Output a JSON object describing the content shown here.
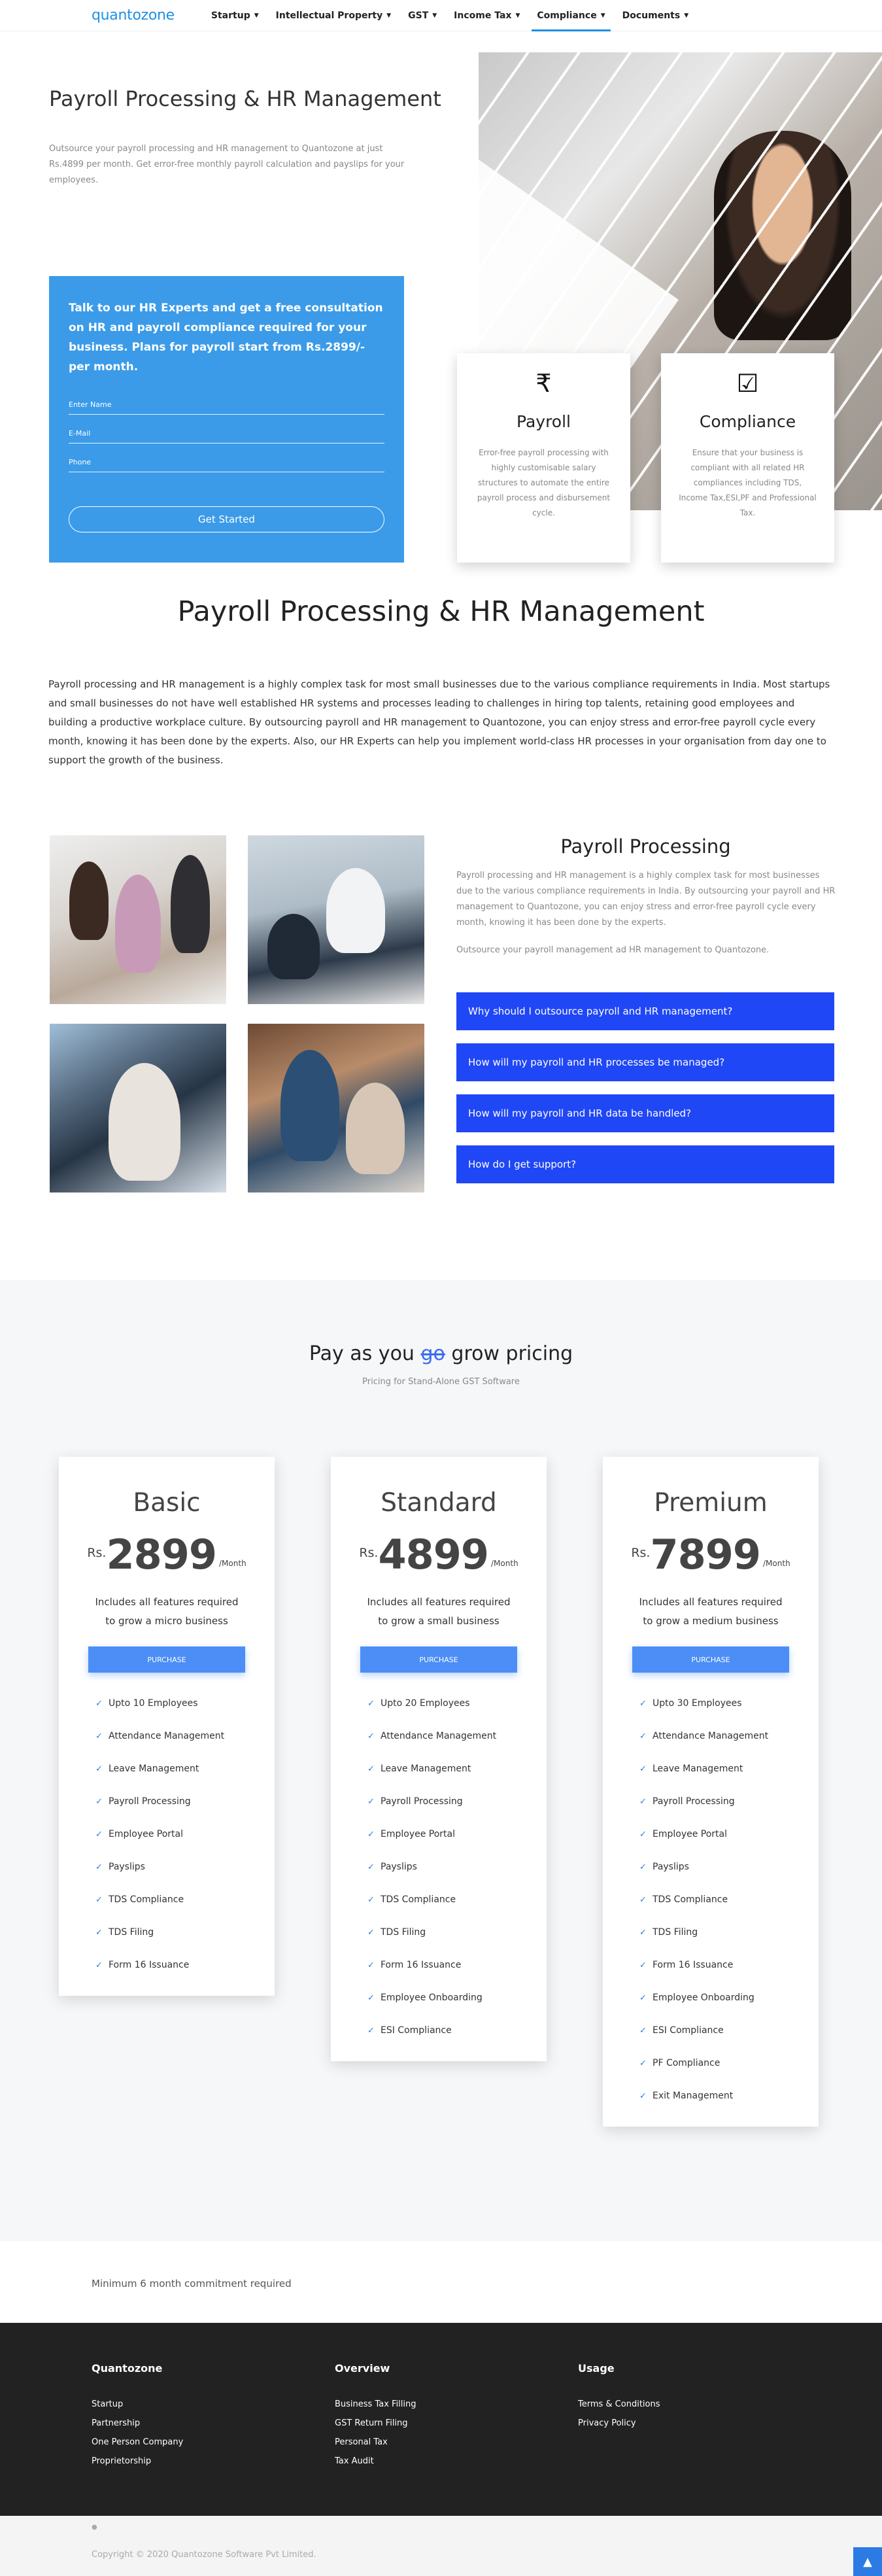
{
  "nav": {
    "logo": "quantozone",
    "items": [
      {
        "label": "Startup"
      },
      {
        "label": "Intellectual Property"
      },
      {
        "label": "GST"
      },
      {
        "label": "Income Tax"
      },
      {
        "label": "Compliance"
      },
      {
        "label": "Documents"
      }
    ],
    "active": "Compliance"
  },
  "hero": {
    "title": "Payroll Processing & HR Management",
    "intro": "Outsource your payroll processing and HR management to Quantozone at just Rs.4899 per month. Get error-free monthly payroll calculation and payslips for your employees.",
    "consult_text": "Talk to our HR Experts and get a free consultation on HR and payroll compliance required for your business. Plans for payroll start from Rs.2899/- per month.",
    "name_placeholder": "Enter Name",
    "email_placeholder": "E-Mail",
    "phone_placeholder": "Phone",
    "cta": "Get Started"
  },
  "features": [
    {
      "icon": "rupee-icon",
      "glyph": "₹",
      "title": "Payroll",
      "text": "Error-free payroll processing with highly customisable salary structures to automate the entire payroll process and disbursement cycle."
    },
    {
      "icon": "checkbox-icon",
      "glyph": "☑",
      "title": "Compliance",
      "text": "Ensure that your business is compliant with all related HR compliances including TDS, Income Tax,ESI,PF and Professional Tax."
    }
  ],
  "section2": {
    "title": "Payroll Processing & HR Management",
    "paragraph": "Payroll processing and HR management is a highly complex task for most small businesses due to the various compliance requirements in India. Most startups and small businesses do not have well established HR systems and processes leading to challenges in hiring top talents, retaining good employees and building a productive workplace culture. By outsourcing payroll and HR management to Quantozone, you can enjoy stress and error-free payroll cycle every month, knowing it has been done by the experts. Also, our HR Experts can help you implement world-class HR processes in your organisation from day one to support the growth of the business."
  },
  "section3": {
    "title": "Payroll Processing",
    "text": "Payroll processing and HR management is a highly complex task for most businesses due to the various compliance requirements in India. By outsourcing your payroll and HR management to Quantozone, you can enjoy stress and error-free payroll cycle every month, knowing it has been done by the experts.",
    "text2": "Outsource your payroll management ad HR management to Quantozone.",
    "faqs": [
      "Why should I outsource payroll and HR management?",
      "How will my payroll and HR processes be managed?",
      "How will my payroll and HR data be handled?",
      "How do I get support?"
    ]
  },
  "pricing": {
    "title_before": "Pay as you ",
    "title_strike": "go",
    "title_after": " grow pricing",
    "subtitle": "Pricing for Stand-Alone GST Software",
    "currency": "Rs.",
    "period": "/Month",
    "plans": [
      {
        "name": "Basic",
        "price": "2899",
        "desc": "Includes all features required to grow a micro business",
        "button": "PURCHASE",
        "features": [
          "Upto 10 Employees",
          "Attendance Management",
          "Leave Management",
          "Payroll Processing",
          "Employee Portal",
          "Payslips",
          "TDS Compliance",
          "TDS Filing",
          "Form 16 Issuance"
        ]
      },
      {
        "name": "Standard",
        "price": "4899",
        "desc": "Includes all features required to grow a small business",
        "button": "PURCHASE",
        "features": [
          "Upto 20 Employees",
          "Attendance Management",
          "Leave Management",
          "Payroll Processing",
          "Employee Portal",
          "Payslips",
          "TDS Compliance",
          "TDS Filing",
          "Form 16 Issuance",
          "Employee Onboarding",
          "ESI Compliance"
        ]
      },
      {
        "name": "Premium",
        "price": "7899",
        "desc": "Includes all features required to grow a medium business",
        "button": "PURCHASE",
        "features": [
          "Upto 30 Employees",
          "Attendance Management",
          "Leave Management",
          "Payroll Processing",
          "Employee Portal",
          "Payslips",
          "TDS Compliance",
          "TDS Filing",
          "Form 16 Issuance",
          "Employee Onboarding",
          "ESI Compliance",
          "PF Compliance",
          "Exit Management"
        ]
      }
    ]
  },
  "commitment": "Minimum 6 month commitment required",
  "footer": {
    "columns": [
      {
        "title": "Quantozone",
        "links": [
          "Startup",
          "Partnership",
          "One Person Company",
          "Proprietorship"
        ]
      },
      {
        "title": "Overview",
        "links": [
          "Business Tax Filling",
          "GST Return Filing",
          "Personal Tax",
          "Tax Audit"
        ]
      },
      {
        "title": "Usage",
        "links": [
          "Terms & Conditions",
          "Privacy Policy"
        ]
      }
    ],
    "copyright": "Copyright © 2020 Quantozone Software Pvt Limited."
  },
  "colors": {
    "accent": "#1e90e6",
    "consult_bg": "#3b9be8",
    "faq_bg": "#2047f5",
    "purchase": "#4c8ef5",
    "footer": "#222222"
  }
}
